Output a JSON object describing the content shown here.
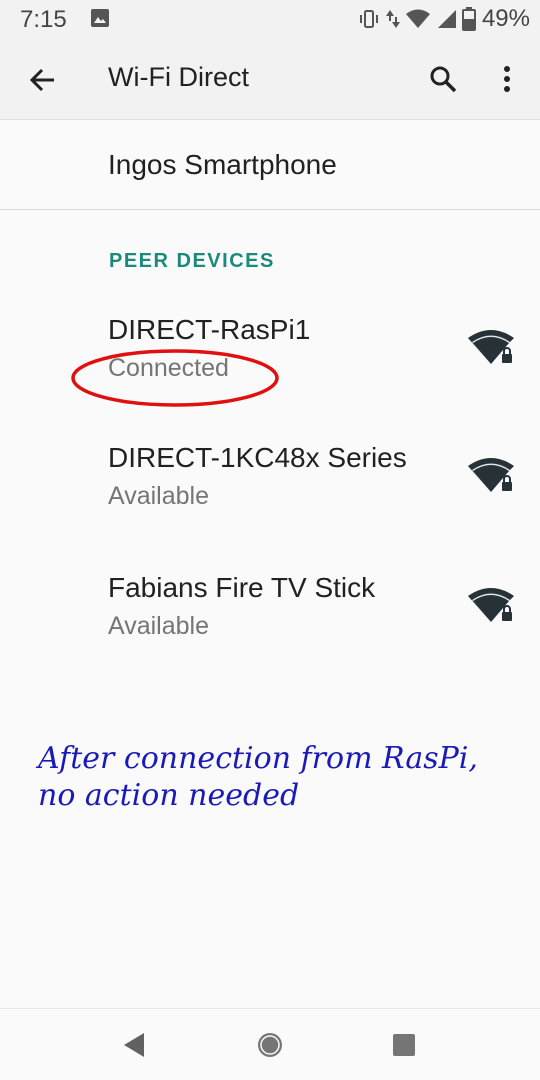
{
  "status_bar": {
    "time": "7:15",
    "battery": "49%"
  },
  "toolbar": {
    "title": "Wi-Fi Direct",
    "back_icon": "arrow-back-icon",
    "search_icon": "search-icon",
    "more_icon": "more-vert-icon"
  },
  "device": {
    "name": "Ingos Smartphone"
  },
  "peer_section": {
    "header": "PEER DEVICES",
    "peers": [
      {
        "name": "DIRECT-RasPi1",
        "status": "Connected"
      },
      {
        "name": "DIRECT-1KC48x Series",
        "status": "Available"
      },
      {
        "name": "Fabians Fire TV Stick",
        "status": "Available"
      }
    ]
  },
  "annotation": {
    "line1": "After connection from RasPi,",
    "line2": "no action needed",
    "color": "#1a1ab8",
    "ellipse_color": "#e01010"
  },
  "colors": {
    "accent": "#1a8a7a",
    "background": "#fafafa",
    "toolbar": "#f2f2f2"
  }
}
